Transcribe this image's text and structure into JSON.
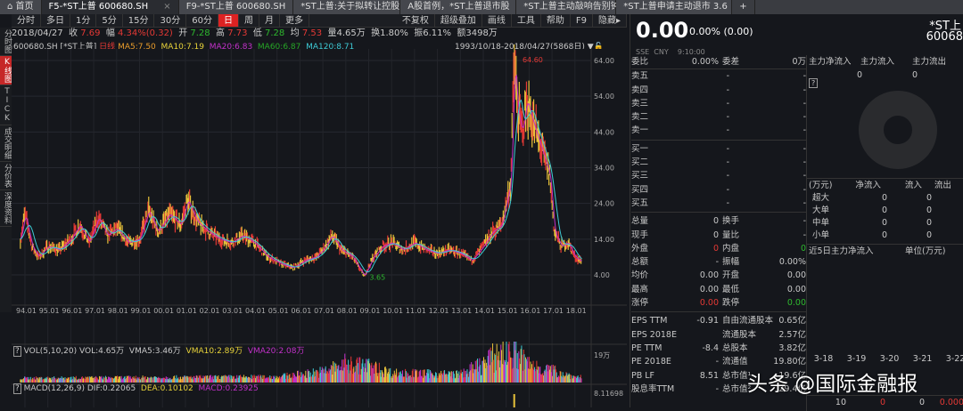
{
  "tabs": [
    {
      "label": "首页",
      "icon": "home-icon"
    },
    {
      "label": "F5-*ST上普 600680.SH",
      "close": "×"
    },
    {
      "label": "F9-*ST上普 600680.SH"
    },
    {
      "label": "*ST上普:关于拟转让控股"
    },
    {
      "label": "A股首例，*ST上普退市股"
    },
    {
      "label": "*ST上普主动敲响告别钟"
    },
    {
      "label": "*ST上普申请主动退市 3.6"
    },
    {
      "label": "+"
    }
  ],
  "toolbar": {
    "periods": [
      "分时",
      "多日",
      "1分",
      "5分",
      "15分",
      "30分",
      "60分",
      "日",
      "周",
      "月",
      "更多"
    ],
    "active": "日",
    "right": [
      "不复权",
      "超级叠加",
      "画线",
      "工具",
      "帮助",
      "F9",
      "隐藏▸"
    ]
  },
  "info": {
    "date": "2018/04/27",
    "close_l": "收",
    "close": "7.69",
    "chg_l": "幅",
    "chg": "4.34%(0.32)",
    "open_l": "开",
    "open": "7.28",
    "high_l": "高",
    "high": "7.73",
    "low_l": "低",
    "low": "7.28",
    "avg_l": "均",
    "avg": "7.53",
    "vol": "量4.65万",
    "turn": "换1.80%",
    "amp": "振6.11%",
    "amt": "额3498万"
  },
  "legend": {
    "code": "600680.SH [*ST上普]",
    "period": "日线",
    "ma5": "MA5:7.50",
    "ma10": "MA10:7.19",
    "ma20": "MA20:6.83",
    "ma60": "MA60:6.87",
    "ma120": "MA120:8.71",
    "range": "1993/10/18-2018/04/27(5868日)"
  },
  "leftnav": [
    "分时图",
    "K线图",
    "TICK",
    "成交明细",
    "分价表",
    "深度资料"
  ],
  "chart_data": {
    "type": "line",
    "ylim": [
      4,
      64
    ],
    "yticks": [
      "64.00",
      "54.00",
      "44.00",
      "34.00",
      "24.00",
      "14.00",
      "4.00"
    ],
    "xticks": [
      "94.01",
      "95.01",
      "96.01",
      "97.01",
      "98.01",
      "99.01",
      "00.01",
      "01.01",
      "02.01",
      "03.01",
      "04.01",
      "05.01",
      "06.01",
      "07.01",
      "08.01",
      "09.01",
      "10.01",
      "11.01",
      "12.01",
      "13.01",
      "14.01",
      "15.01",
      "16.01",
      "17.01",
      "18.01"
    ],
    "high_label": "64.60",
    "low_label": "3.65",
    "price_path": [
      [
        1993.8,
        14
      ],
      [
        1994.0,
        21
      ],
      [
        1994.3,
        12
      ],
      [
        1994.6,
        9
      ],
      [
        1995.0,
        12
      ],
      [
        1995.5,
        11
      ],
      [
        1996.0,
        14
      ],
      [
        1996.4,
        18
      ],
      [
        1996.8,
        13
      ],
      [
        1997.2,
        20
      ],
      [
        1997.6,
        15
      ],
      [
        1998.0,
        17
      ],
      [
        1998.5,
        13
      ],
      [
        1999.0,
        14
      ],
      [
        1999.4,
        22
      ],
      [
        1999.8,
        16
      ],
      [
        2000.3,
        21
      ],
      [
        2000.8,
        18
      ],
      [
        2001.1,
        25
      ],
      [
        2001.5,
        19
      ],
      [
        2002.0,
        16
      ],
      [
        2002.5,
        14
      ],
      [
        2003.0,
        13
      ],
      [
        2003.5,
        15
      ],
      [
        2004.0,
        13
      ],
      [
        2004.6,
        9
      ],
      [
        2005.2,
        7
      ],
      [
        2005.7,
        6
      ],
      [
        2006.2,
        8
      ],
      [
        2006.7,
        9
      ],
      [
        2007.0,
        11
      ],
      [
        2007.4,
        15
      ],
      [
        2007.8,
        11
      ],
      [
        2008.3,
        9
      ],
      [
        2008.8,
        3.65
      ],
      [
        2009.2,
        9
      ],
      [
        2009.6,
        12
      ],
      [
        2010.0,
        13
      ],
      [
        2010.5,
        11
      ],
      [
        2011.0,
        13
      ],
      [
        2011.5,
        11
      ],
      [
        2012.0,
        10
      ],
      [
        2012.5,
        11
      ],
      [
        2013.0,
        10
      ],
      [
        2013.5,
        8
      ],
      [
        2014.0,
        12
      ],
      [
        2014.4,
        16
      ],
      [
        2014.8,
        18
      ],
      [
        2015.0,
        24
      ],
      [
        2015.2,
        30
      ],
      [
        2015.35,
        64.6
      ],
      [
        2015.5,
        50
      ],
      [
        2015.7,
        44
      ],
      [
        2015.9,
        53
      ],
      [
        2016.2,
        46
      ],
      [
        2016.6,
        38
      ],
      [
        2016.9,
        32
      ],
      [
        2017.1,
        16
      ],
      [
        2017.4,
        12
      ],
      [
        2017.7,
        13
      ],
      [
        2018.0,
        9
      ],
      [
        2018.3,
        7.69
      ]
    ],
    "vol_label": "VOL(5,10,20) VOL:4.65万",
    "vma5": "VMA5:3.46万",
    "vma10": "VMA10:2.89万",
    "vma20": "VMA20:2.08万",
    "vol_tick": "19万",
    "volume_profile": [
      [
        1994,
        2
      ],
      [
        2005,
        3
      ],
      [
        2007,
        7
      ],
      [
        2008,
        13
      ],
      [
        2009,
        11
      ],
      [
        2010,
        6
      ],
      [
        2013,
        5
      ],
      [
        2014,
        13
      ],
      [
        2015,
        24
      ],
      [
        2015.5,
        20
      ],
      [
        2016,
        12
      ],
      [
        2017,
        8
      ],
      [
        2018,
        3
      ]
    ],
    "macd_label": "MACD(12,26,9) DIF:0.22065",
    "dea": "DEA:0.10102",
    "macd": "MACD:0.23925",
    "macd_tick": "8.11698"
  },
  "quote": {
    "price": "0.00",
    "change": "0.00% (0.00)",
    "exch": "SSE  CNY    9:10:00",
    "name": "*ST上",
    "code": "60068"
  },
  "book": {
    "wb_l": "委比",
    "wb": "0.00%",
    "wc_l": "委差",
    "wc": "0万",
    "asks": [
      "卖五",
      "卖四",
      "卖三",
      "卖二",
      "卖一"
    ],
    "bids": [
      "买一",
      "买二",
      "买三",
      "买四",
      "买五"
    ],
    "dash": "-",
    "stats": [
      [
        "总量",
        "0",
        "换手",
        "-"
      ],
      [
        "现手",
        "0",
        "量比",
        "-"
      ],
      [
        "外盘",
        "0",
        "内盘",
        "0"
      ],
      [
        "总额",
        "-",
        "振幅",
        "0.00%"
      ],
      [
        "均价",
        "0.00",
        "开盘",
        "0.00"
      ],
      [
        "最高",
        "0.00",
        "最低",
        "0.00"
      ],
      [
        "涨停",
        "0.00",
        "跌停",
        "0.00"
      ]
    ],
    "fund": [
      [
        "EPS TTM",
        "-0.91",
        "自由流通股本",
        "0.65亿"
      ],
      [
        "EPS 2018E",
        "",
        "流通股本",
        "2.57亿"
      ],
      [
        "PE TTM",
        "-8.4",
        "总股本",
        "3.82亿"
      ],
      [
        "PE 2018E",
        "-",
        "流通值",
        "19.80亿"
      ],
      [
        "PB LF",
        "8.51",
        "总市值¹",
        "19.6亿"
      ],
      [
        "股息率TTM",
        "-",
        "总市值²",
        "29.4亿"
      ]
    ]
  },
  "flow": {
    "h": [
      "主力净流入",
      "主力流入",
      "主力流出"
    ],
    "v": [
      "0",
      "0"
    ],
    "help": "?",
    "unit": "(万元)",
    "cols": [
      "净流入",
      "流入",
      "流出"
    ],
    "rows": [
      [
        "超大",
        "0",
        "0"
      ],
      [
        "大单",
        "0",
        "0"
      ],
      [
        "中单",
        "0",
        "0"
      ],
      [
        "小单",
        "0",
        "0"
      ]
    ],
    "five": "近5日主力净流入",
    "five_unit": "单位(万元)",
    "dates": [
      "3-18",
      "3-19",
      "3-20",
      "3-21",
      "3-22"
    ],
    "bottom": [
      "10",
      "0",
      "0",
      "0.000"
    ]
  },
  "watermark": "头条 @国际金融报"
}
